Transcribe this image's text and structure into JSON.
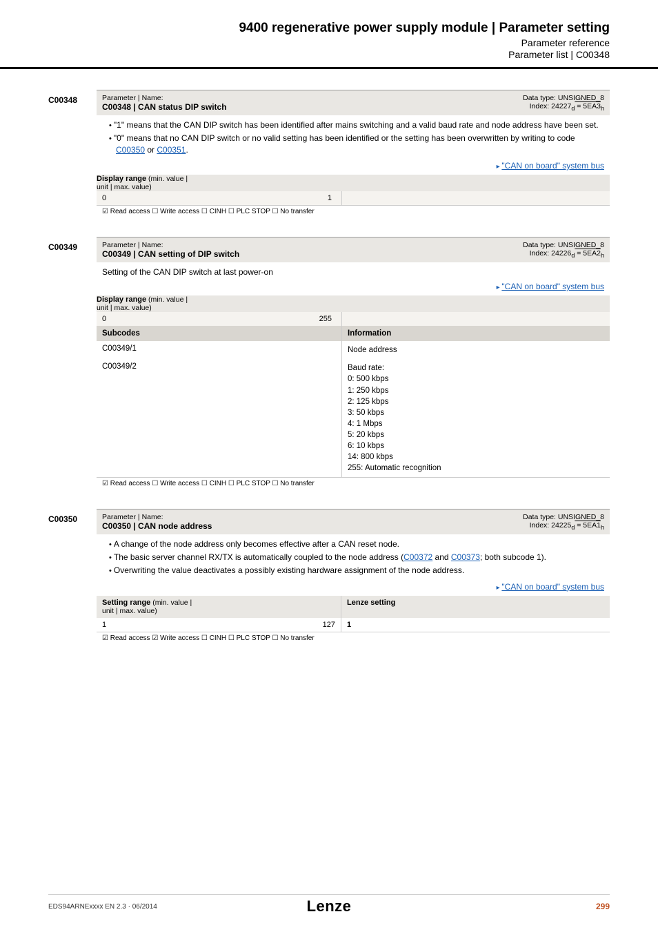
{
  "header": {
    "title": "9400 regenerative power supply module | Parameter setting",
    "sub1": "Parameter reference",
    "sub2": "Parameter list | C00348"
  },
  "params": [
    {
      "id": "C00348",
      "name_label": "Parameter | Name:",
      "name": "C00348 | CAN status DIP switch",
      "dtype_line1": "Data type: UNSIGNED_8",
      "dtype_index_prefix": "Index: 24227",
      "dtype_index_d": "d",
      "dtype_index_eq": " = 5EA3",
      "dtype_index_h": "h",
      "desc_items": [
        {
          "pre": "\"1\" means that the CAN DIP switch has been identified after mains switching and a valid baud rate and node address have been set."
        },
        {
          "pre": "\"0\" means that no CAN DIP switch or no valid setting has been identified or the setting has been overwritten by writing to code ",
          "link1": "C00350",
          "mid": " or ",
          "link2": "C00351",
          "post": "."
        }
      ],
      "right_link": "\"CAN on board\" system bus",
      "display_range_label": "Display range",
      "display_range_sub": " (min. value | unit | max. value)",
      "dr_min": "0",
      "dr_max": "1",
      "access": "☑ Read access   ☐ Write access   ☐ CINH   ☐ PLC STOP   ☐ No transfer"
    },
    {
      "id": "C00349",
      "name_label": "Parameter | Name:",
      "name": "C00349 | CAN setting of DIP switch",
      "dtype_line1": "Data type: UNSIGNED_8",
      "dtype_index_prefix": "Index: 24226",
      "dtype_index_d": "d",
      "dtype_index_eq": " = 5EA2",
      "dtype_index_h": "h",
      "desc_plain": "Setting of the CAN DIP switch at last power-on",
      "right_link": "\"CAN on board\" system bus",
      "display_range_label": "Display range",
      "display_range_sub": " (min. value | unit | max. value)",
      "dr_min": "0",
      "dr_max": "255",
      "subcodes_h_left": "Subcodes",
      "subcodes_h_right": "Information",
      "subcodes": [
        {
          "code": "C00349/1",
          "info": "Node address"
        },
        {
          "code": "C00349/2",
          "info": "Baud rate:\n0: 500 kbps\n1: 250 kbps\n2: 125 kbps\n3: 50 kbps\n4: 1 Mbps\n5: 20 kbps\n6: 10 kbps\n14: 800 kbps\n255: Automatic recognition"
        }
      ],
      "access": "☑ Read access   ☐ Write access   ☐ CINH   ☐ PLC STOP   ☐ No transfer"
    },
    {
      "id": "C00350",
      "name_label": "Parameter | Name:",
      "name": "C00350 | CAN node address",
      "dtype_line1": "Data type: UNSIGNED_8",
      "dtype_index_prefix": "Index: 24225",
      "dtype_index_d": "d",
      "dtype_index_eq": " = 5EA1",
      "dtype_index_h": "h",
      "desc_items": [
        {
          "pre": "A change of the node address only becomes effective after a CAN reset node."
        },
        {
          "pre": "The basic server channel RX/TX is automatically coupled to the node address (",
          "link1": "C00372",
          "mid": " and ",
          "link2": "C00373",
          "post": "; both subcode 1)."
        },
        {
          "pre": "Overwriting the value deactivates a possibly existing hardware assignment of the node address."
        }
      ],
      "right_link": "\"CAN on board\" system bus",
      "setting_range_label": "Setting range",
      "setting_range_sub": " (min. value | unit | max. value)",
      "lenze_label": "Lenze setting",
      "sr_min": "1",
      "sr_max": "127",
      "sr_lenze": "1",
      "access": "☑ Read access   ☑ Write access   ☐ CINH   ☐ PLC STOP   ☐ No transfer"
    }
  ],
  "footer": {
    "left": "EDS94ARNExxxx EN 2.3 · 06/2014",
    "center": "Lenze",
    "right": "299"
  }
}
